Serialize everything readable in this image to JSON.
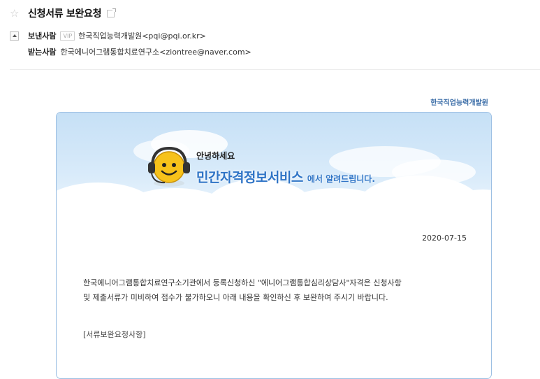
{
  "email": {
    "subject": "신청서류 보완요청",
    "from": {
      "label": "보낸사람",
      "badge": "VIP",
      "value": "한국직업능력개발원<pqi@pqi.or.kr>"
    },
    "to": {
      "label": "받는사람",
      "value": "한국에니어그램통합치료연구소<ziontree@naver.com>"
    }
  },
  "content": {
    "org": "한국직업능력개발원",
    "greeting": "안녕하세요",
    "service": "민간자격정보서비스",
    "service_suffix": "에서 알려드립니다.",
    "date": "2020-07-15",
    "body_line1": "한국에니어그램통합치료연구소기관에서 등록신청하신 \"에니어그램통합심리상담사\"자격은 신청사항",
    "body_line2": "및 제출서류가 미비하여 접수가 불가하오니 아래 내용을 확인하신 후 보완하여 주시기 바랍니다.",
    "section_title": "[서류보완요청사항]"
  },
  "colors": {
    "accent": "#2f74c6",
    "sky": "#c6e0f6",
    "border": "#9cbfe3"
  },
  "icons": [
    "star-icon",
    "popout-icon",
    "toggle-icon",
    "smiley-icon"
  ]
}
